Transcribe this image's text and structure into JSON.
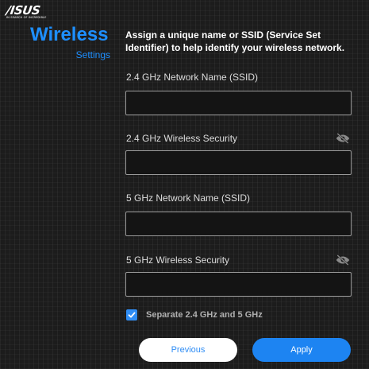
{
  "brand": {
    "logo_text": "/ISUS",
    "tagline": "IN SEARCH OF INCREDIBLE"
  },
  "header": {
    "title": "Wireless",
    "subtitle": "Settings",
    "description": "Assign a unique name or SSID (Service Set Identifier) to help identify your wireless network."
  },
  "form": {
    "ssid_24_label": "2.4 GHz Network Name (SSID)",
    "ssid_24_value": "",
    "security_24_label": "2.4 GHz Wireless Security",
    "security_24_value": "",
    "ssid_5_label": "5 GHz Network Name (SSID)",
    "ssid_5_value": "",
    "security_5_label": "5 GHz Wireless Security",
    "security_5_value": "",
    "separate_label": "Separate 2.4 GHz and 5 GHz",
    "separate_checked": true
  },
  "actions": {
    "previous_label": "Previous",
    "apply_label": "Apply"
  },
  "icons": {
    "password_toggle": "eye-slash-icon",
    "checkbox": "checkmark-icon"
  },
  "colors": {
    "accent": "#1e8fff",
    "apply_button": "#1d84f2",
    "background": "#1c1c1c"
  }
}
